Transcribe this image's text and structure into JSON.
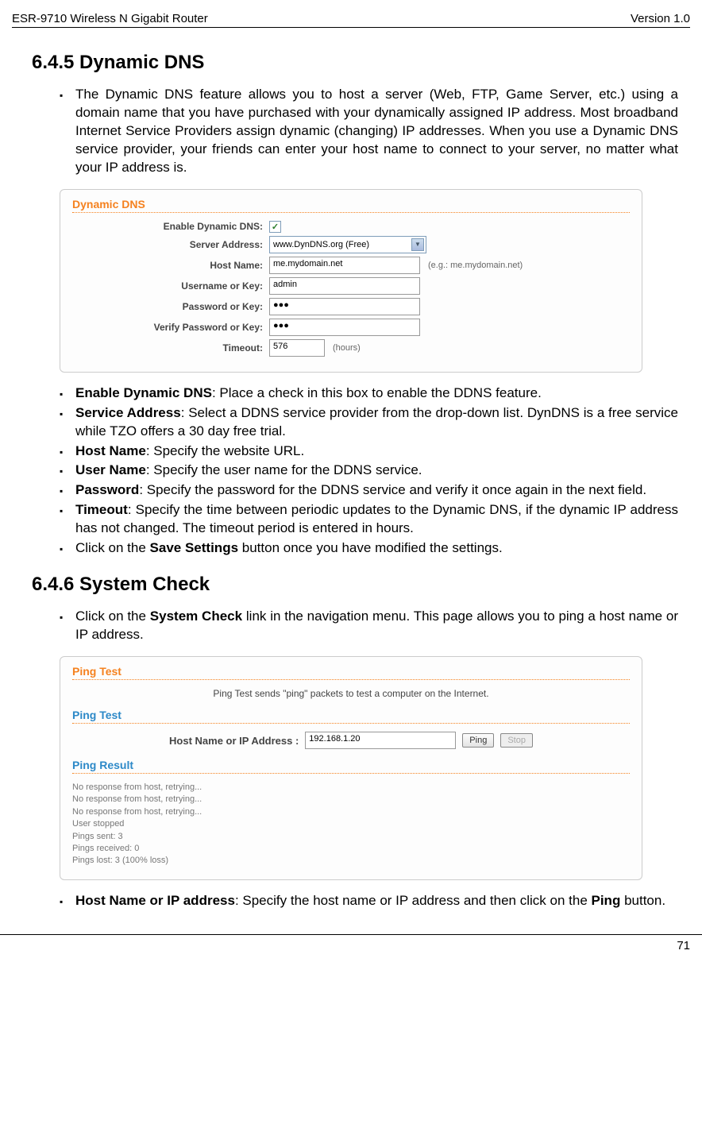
{
  "header": {
    "left": "ESR-9710 Wireless N Gigabit Router",
    "right": "Version 1.0"
  },
  "section1": {
    "heading": "6.4.5 Dynamic DNS",
    "intro": "The Dynamic DNS feature allows you to host a server (Web, FTP, Game Server, etc.) using a domain name that you have purchased with your dynamically assigned IP address. Most broadband Internet Service Providers assign dynamic (changing) IP addresses. When you use a Dynamic DNS service provider, your friends can enter your host name to connect to your server, no matter what your IP address is."
  },
  "ddns_panel": {
    "title": "Dynamic DNS",
    "enable_label": "Enable Dynamic DNS:",
    "server_label": "Server Address:",
    "server_value": "www.DynDNS.org (Free)",
    "host_label": "Host Name:",
    "host_value": "me.mydomain.net",
    "host_hint": "(e.g.: me.mydomain.net)",
    "user_label": "Username or Key:",
    "user_value": "admin",
    "pass_label": "Password or Key:",
    "pass_value": "●●●",
    "verify_label": "Verify Password or Key:",
    "verify_value": "●●●",
    "timeout_label": "Timeout:",
    "timeout_value": "576",
    "timeout_hint": "(hours)"
  },
  "bullets1": {
    "b1_bold": "Enable Dynamic DNS",
    "b1_rest": ": Place a check in this box to enable the DDNS feature.",
    "b2_bold": "Service Address",
    "b2_rest": ": Select a DDNS service provider from the drop-down list. DynDNS is a free service while TZO offers a 30 day free trial.",
    "b3_bold": "Host Name",
    "b3_rest": ": Specify the website URL.",
    "b4_bold": "User Name",
    "b4_rest": ": Specify the user name for the DDNS service.",
    "b5_bold": "Password",
    "b5_rest": ": Specify the password for the DDNS service and verify it once again in the next field.",
    "b6_bold": "Timeout",
    "b6_rest": ": Specify the time between periodic updates to the Dynamic DNS, if the dynamic IP address has not changed. The timeout period is entered in hours.",
    "b7_pre": "Click on the ",
    "b7_bold": "Save Settings",
    "b7_rest": " button once you have modified the settings."
  },
  "section2": {
    "heading": "6.4.6 System Check",
    "intro_pre": "Click on the ",
    "intro_bold": "System Check",
    "intro_rest": " link in the navigation menu. This page allows you to ping a host name or IP address."
  },
  "ping_panel": {
    "title": "Ping Test",
    "desc": "Ping Test sends \"ping\" packets to test a computer on the Internet.",
    "sub_test": "Ping Test",
    "input_label": "Host Name or IP Address :",
    "input_value": "192.168.1.20",
    "ping_btn": "Ping",
    "stop_btn": "Stop",
    "sub_result": "Ping Result",
    "result_lines": "No response from host, retrying...\nNo response from host, retrying...\nNo response from host, retrying...\nUser stopped\nPings sent: 3\nPings received: 0\nPings lost: 3 (100% loss)"
  },
  "bullets2": {
    "b1_bold": "Host Name or IP address",
    "b1_rest": ": Specify the host name or IP address and then click on the ",
    "b1_bold2": "Ping",
    "b1_rest2": " button."
  },
  "footer": {
    "page_number": "71"
  }
}
